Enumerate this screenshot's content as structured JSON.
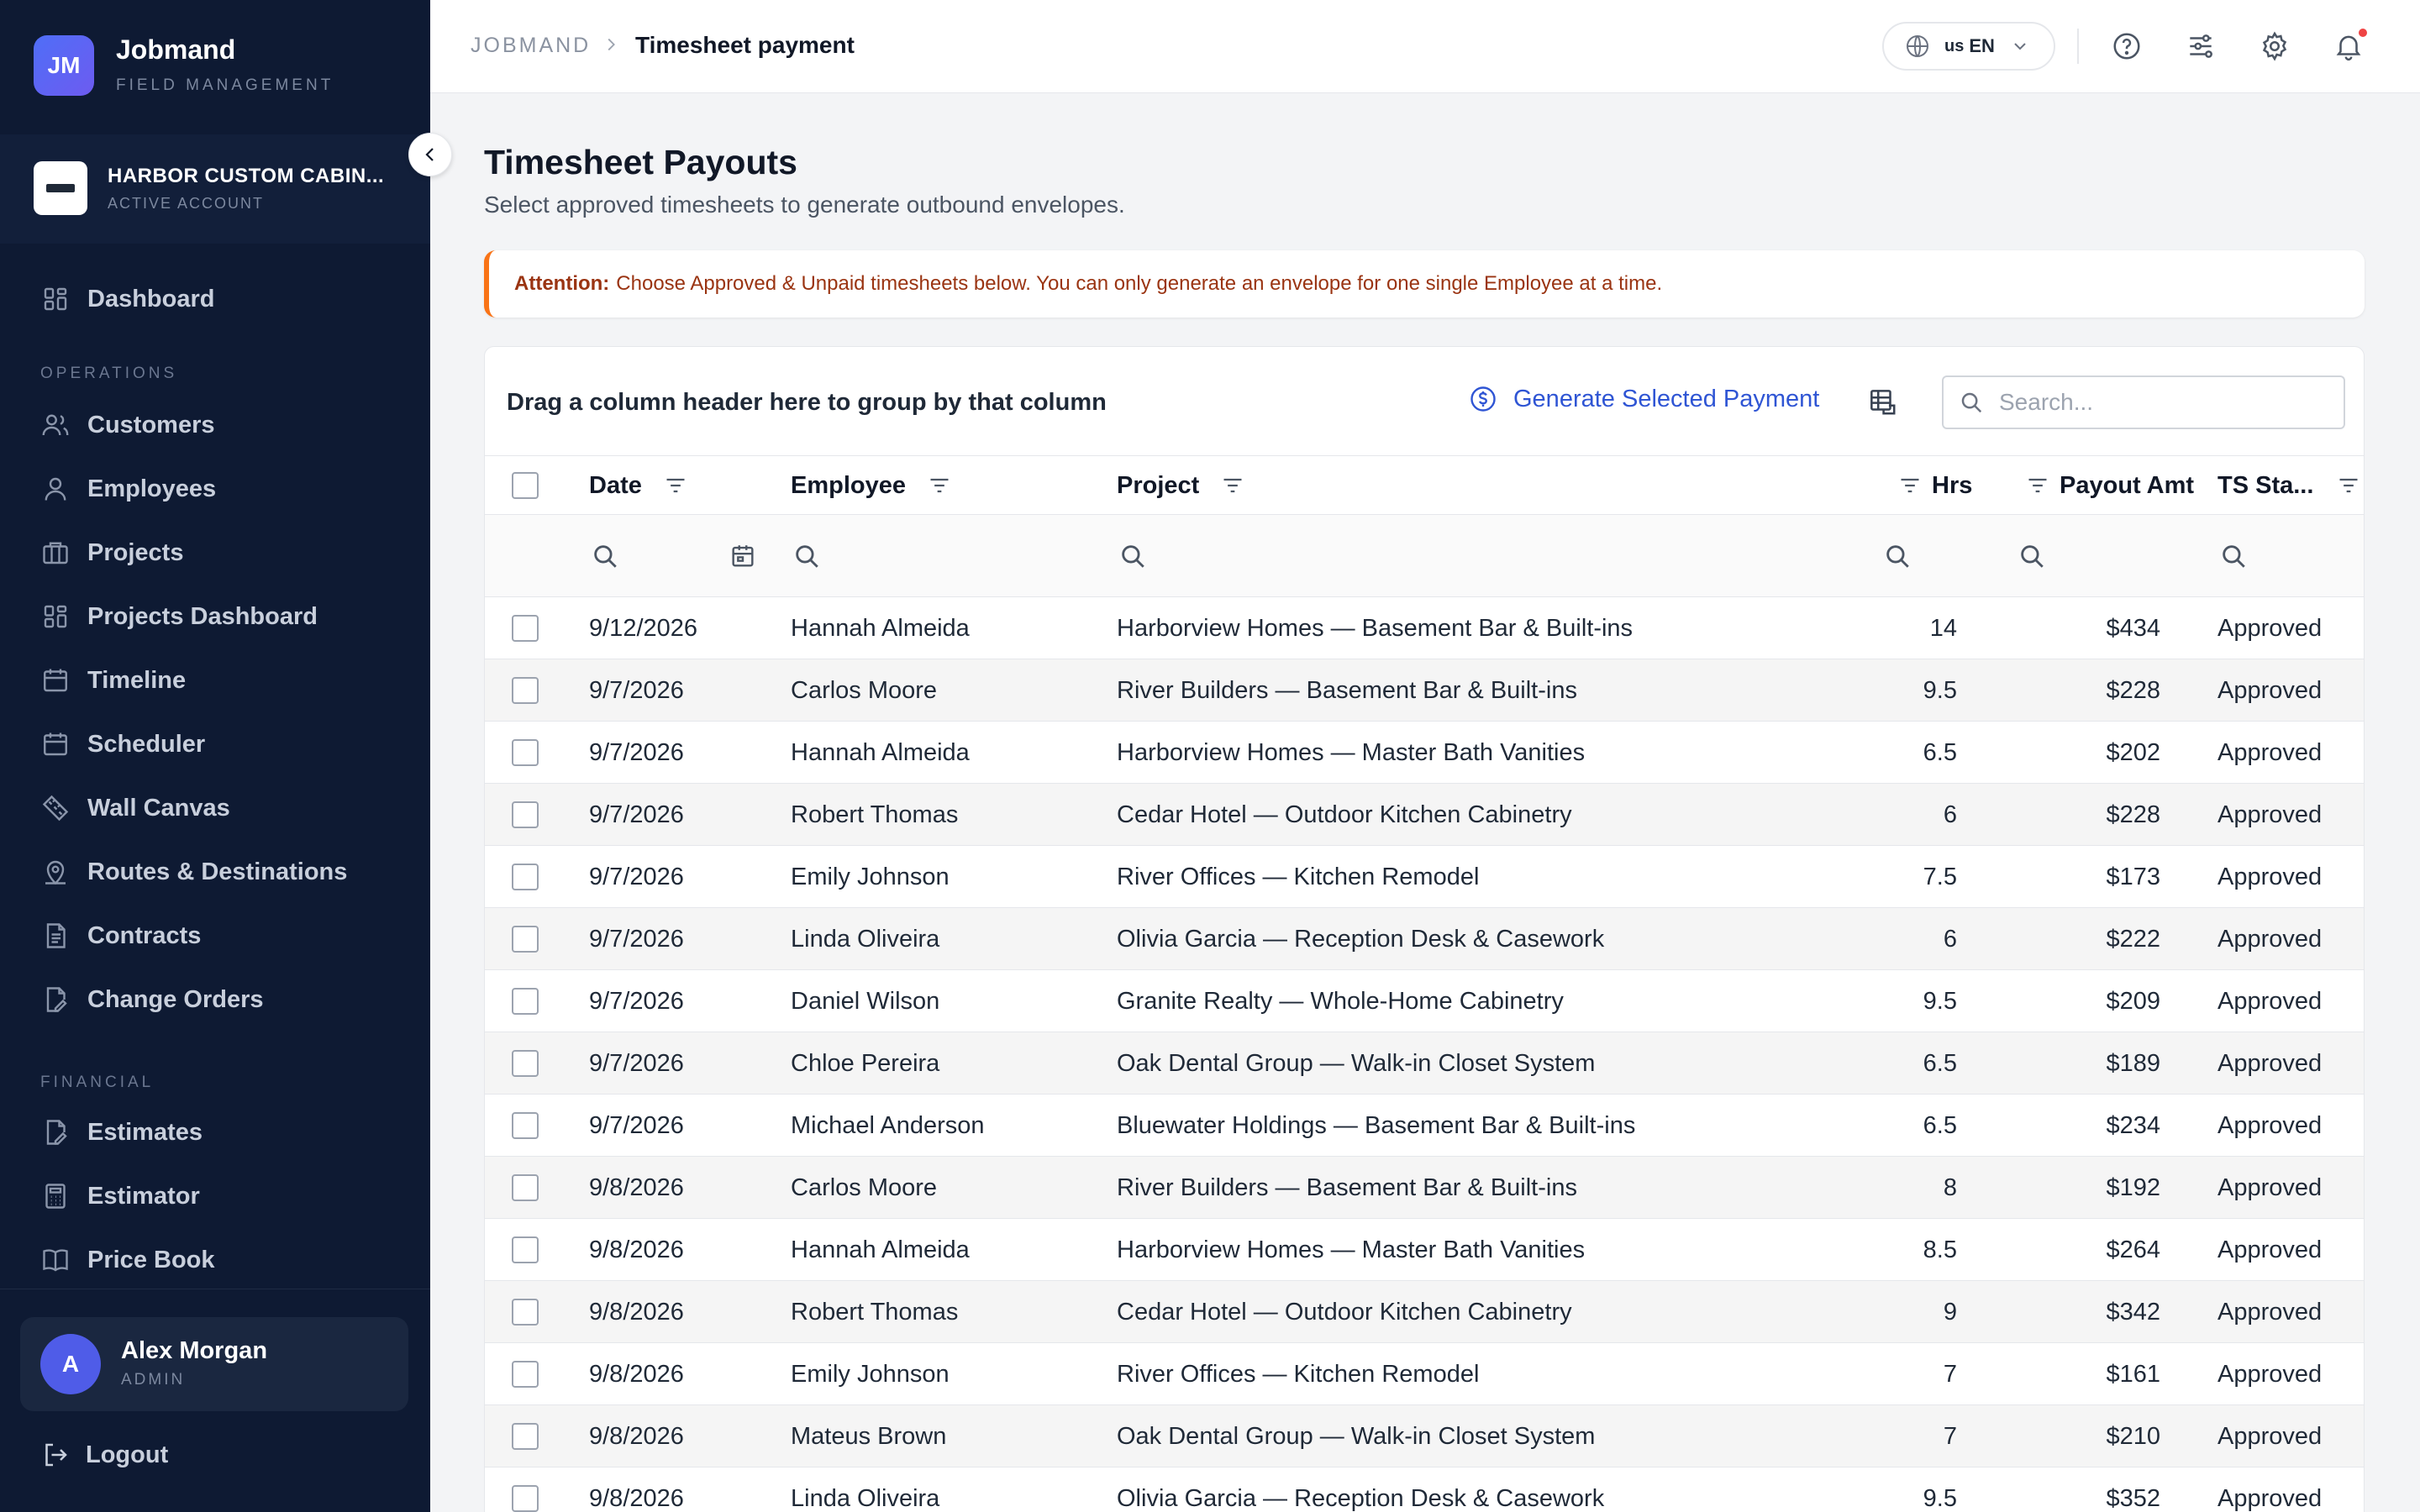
{
  "brand": {
    "initials": "JM",
    "name": "Jobmand",
    "subtitle": "FIELD MANAGEMENT"
  },
  "account": {
    "name": "HARBOR CUSTOM CABIN...",
    "status": "ACTIVE ACCOUNT"
  },
  "nav": {
    "items": [
      {
        "label": "Dashboard",
        "icon": "grid-icon"
      },
      {
        "label": "Customers",
        "icon": "users-icon"
      },
      {
        "label": "Employees",
        "icon": "user-icon"
      },
      {
        "label": "Projects",
        "icon": "briefcase-icon"
      },
      {
        "label": "Projects Dashboard",
        "icon": "grid-icon"
      },
      {
        "label": "Timeline",
        "icon": "calendar-icon"
      },
      {
        "label": "Scheduler",
        "icon": "calendar-icon"
      },
      {
        "label": "Wall Canvas",
        "icon": "ruler-icon"
      },
      {
        "label": "Routes & Destinations",
        "icon": "map-pin-icon"
      },
      {
        "label": "Contracts",
        "icon": "document-icon"
      },
      {
        "label": "Change Orders",
        "icon": "document-edit-icon"
      },
      {
        "label": "Estimates",
        "icon": "document-edit-icon"
      },
      {
        "label": "Estimator",
        "icon": "calculator-icon"
      },
      {
        "label": "Price Book",
        "icon": "book-icon"
      }
    ],
    "sections": {
      "operations": "OPERATIONS",
      "financial": "FINANCIAL"
    }
  },
  "user": {
    "initial": "A",
    "name": "Alex Morgan",
    "role": "ADMIN"
  },
  "logout_label": "Logout",
  "breadcrumb": {
    "root": "JOBMAND",
    "current": "Timesheet payment"
  },
  "language": {
    "flag": "us",
    "code": "EN"
  },
  "page": {
    "title": "Timesheet Payouts",
    "subtitle": "Select approved timesheets to generate outbound envelopes."
  },
  "alert": {
    "label": "Attention:",
    "text": "Choose Approved & Unpaid timesheets below. You can only generate an envelope for one single Employee at a time."
  },
  "grid": {
    "group_hint": "Drag a column header here to group by that column",
    "generate_label": "Generate Selected Payment",
    "search_placeholder": "Search...",
    "columns": {
      "date": "Date",
      "employee": "Employee",
      "project": "Project",
      "hrs": "Hrs",
      "payout": "Payout Amt",
      "status": "TS Sta..."
    },
    "rows": [
      {
        "date": "9/12/2026",
        "employee": "Hannah Almeida",
        "project": "Harborview Homes — Basement Bar & Built-ins",
        "hrs": "14",
        "payout": "$434",
        "status": "Approved"
      },
      {
        "date": "9/7/2026",
        "employee": "Carlos Moore",
        "project": "River Builders — Basement Bar & Built-ins",
        "hrs": "9.5",
        "payout": "$228",
        "status": "Approved"
      },
      {
        "date": "9/7/2026",
        "employee": "Hannah Almeida",
        "project": "Harborview Homes — Master Bath Vanities",
        "hrs": "6.5",
        "payout": "$202",
        "status": "Approved"
      },
      {
        "date": "9/7/2026",
        "employee": "Robert Thomas",
        "project": "Cedar Hotel — Outdoor Kitchen Cabinetry",
        "hrs": "6",
        "payout": "$228",
        "status": "Approved"
      },
      {
        "date": "9/7/2026",
        "employee": "Emily Johnson",
        "project": "River Offices — Kitchen Remodel",
        "hrs": "7.5",
        "payout": "$173",
        "status": "Approved"
      },
      {
        "date": "9/7/2026",
        "employee": "Linda Oliveira",
        "project": "Olivia Garcia — Reception Desk & Casework",
        "hrs": "6",
        "payout": "$222",
        "status": "Approved"
      },
      {
        "date": "9/7/2026",
        "employee": "Daniel Wilson",
        "project": "Granite Realty — Whole-Home Cabinetry",
        "hrs": "9.5",
        "payout": "$209",
        "status": "Approved"
      },
      {
        "date": "9/7/2026",
        "employee": "Chloe Pereira",
        "project": "Oak Dental Group — Walk-in Closet System",
        "hrs": "6.5",
        "payout": "$189",
        "status": "Approved"
      },
      {
        "date": "9/7/2026",
        "employee": "Michael Anderson",
        "project": "Bluewater Holdings — Basement Bar & Built-ins",
        "hrs": "6.5",
        "payout": "$234",
        "status": "Approved"
      },
      {
        "date": "9/8/2026",
        "employee": "Carlos Moore",
        "project": "River Builders — Basement Bar & Built-ins",
        "hrs": "8",
        "payout": "$192",
        "status": "Approved"
      },
      {
        "date": "9/8/2026",
        "employee": "Hannah Almeida",
        "project": "Harborview Homes — Master Bath Vanities",
        "hrs": "8.5",
        "payout": "$264",
        "status": "Approved"
      },
      {
        "date": "9/8/2026",
        "employee": "Robert Thomas",
        "project": "Cedar Hotel — Outdoor Kitchen Cabinetry",
        "hrs": "9",
        "payout": "$342",
        "status": "Approved"
      },
      {
        "date": "9/8/2026",
        "employee": "Emily Johnson",
        "project": "River Offices — Kitchen Remodel",
        "hrs": "7",
        "payout": "$161",
        "status": "Approved"
      },
      {
        "date": "9/8/2026",
        "employee": "Mateus Brown",
        "project": "Oak Dental Group — Walk-in Closet System",
        "hrs": "7",
        "payout": "$210",
        "status": "Approved"
      },
      {
        "date": "9/8/2026",
        "employee": "Linda Oliveira",
        "project": "Olivia Garcia — Reception Desk & Casework",
        "hrs": "9.5",
        "payout": "$352",
        "status": "Approved"
      }
    ]
  },
  "colors": {
    "sidebar_bg": "#0e1a33",
    "accent": "#2f55d4",
    "alert_border": "#f97316",
    "alert_text": "#9a3412",
    "notification": "#ef4444"
  }
}
